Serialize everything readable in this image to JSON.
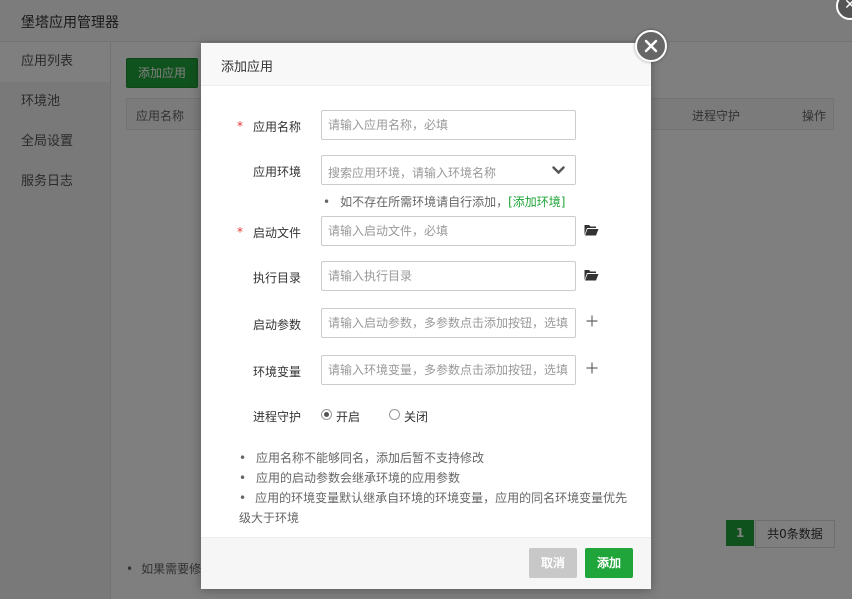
{
  "window": {
    "title": "堡塔应用管理器"
  },
  "sidebar": {
    "items": [
      {
        "label": "应用列表"
      },
      {
        "label": "环境池"
      },
      {
        "label": "全局设置"
      },
      {
        "label": "服务日志"
      }
    ]
  },
  "main": {
    "add_button": "添加应用",
    "table": {
      "headers": [
        "应用名称",
        "进程守护",
        "操作"
      ]
    },
    "pager": {
      "current": "1",
      "total_text": "共0条数据"
    },
    "tip": "如果需要修"
  },
  "modal": {
    "title": "添加应用",
    "fields": {
      "app_name": {
        "required_mark": "*",
        "label": "应用名称",
        "placeholder": "请输入应用名称，必填"
      },
      "app_env": {
        "label": "应用环境",
        "placeholder": "搜索应用环境，请输入环境名称"
      },
      "start_file": {
        "required_mark": "*",
        "label": "启动文件",
        "placeholder": "请输入启动文件，必填"
      },
      "exec_dir": {
        "label": "执行目录",
        "placeholder": "请输入执行目录"
      },
      "start_args": {
        "label": "启动参数",
        "placeholder": "请输入启动参数，多参数点击添加按钮，选填"
      },
      "env_vars": {
        "label": "环境变量",
        "placeholder": "请输入环境变量，多参数点击添加按钮，选填"
      }
    },
    "env_hint": {
      "text": "如不存在所需环境请自行添加，",
      "link": "[添加环境]"
    },
    "daemon": {
      "label": "进程守护",
      "on_label": "开启",
      "off_label": "关闭",
      "selected": "开启"
    },
    "notes": [
      "应用名称不能够同名，添加后暂不支持修改",
      "应用的启动参数会继承环境的应用参数",
      "应用的环境变量默认继承自环境的环境变量，应用的同名环境变量优先级大于环境"
    ],
    "buttons": {
      "cancel": "取消",
      "confirm": "添加"
    }
  },
  "colors": {
    "accent": "#20a53a",
    "required": "#e53935",
    "cancel_bg": "#c8c8c8"
  },
  "icons": [
    "close-icon",
    "chevron-down-icon",
    "folder-open-icon",
    "plus-icon"
  ]
}
